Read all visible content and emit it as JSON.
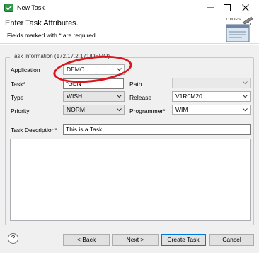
{
  "window": {
    "title": "New Task",
    "controls": [
      "minimize-icon",
      "maximize-icon",
      "close-icon"
    ]
  },
  "header": {
    "title": "Enter Task Attributes.",
    "subtitle": "Fields marked with * are required",
    "logo_text": "TD/OMS"
  },
  "group": {
    "label": "Task Information (172.17.2.171/DEMO)"
  },
  "form": {
    "application": {
      "label": "Application",
      "value": "DEMO"
    },
    "task": {
      "label": "Task*",
      "value": "*GEN"
    },
    "path": {
      "label": "Path",
      "value": ""
    },
    "type": {
      "label": "Type",
      "value": "WISH"
    },
    "release": {
      "label": "Release",
      "value": "V1R0M20"
    },
    "priority": {
      "label": "Priority",
      "value": "NORM"
    },
    "programmer": {
      "label": "Programmer*",
      "value": "WIM"
    },
    "description": {
      "label": "Task Description*",
      "value": "This is a Task"
    },
    "notes": {
      "value": ""
    }
  },
  "buttons": {
    "help": "?",
    "back": "< Back",
    "next": "Next >",
    "create": "Create Task",
    "cancel": "Cancel"
  },
  "colors": {
    "highlight": "#d9161e",
    "default_button_border": "#0078d7",
    "dialog_background": "#f0f0f0"
  }
}
